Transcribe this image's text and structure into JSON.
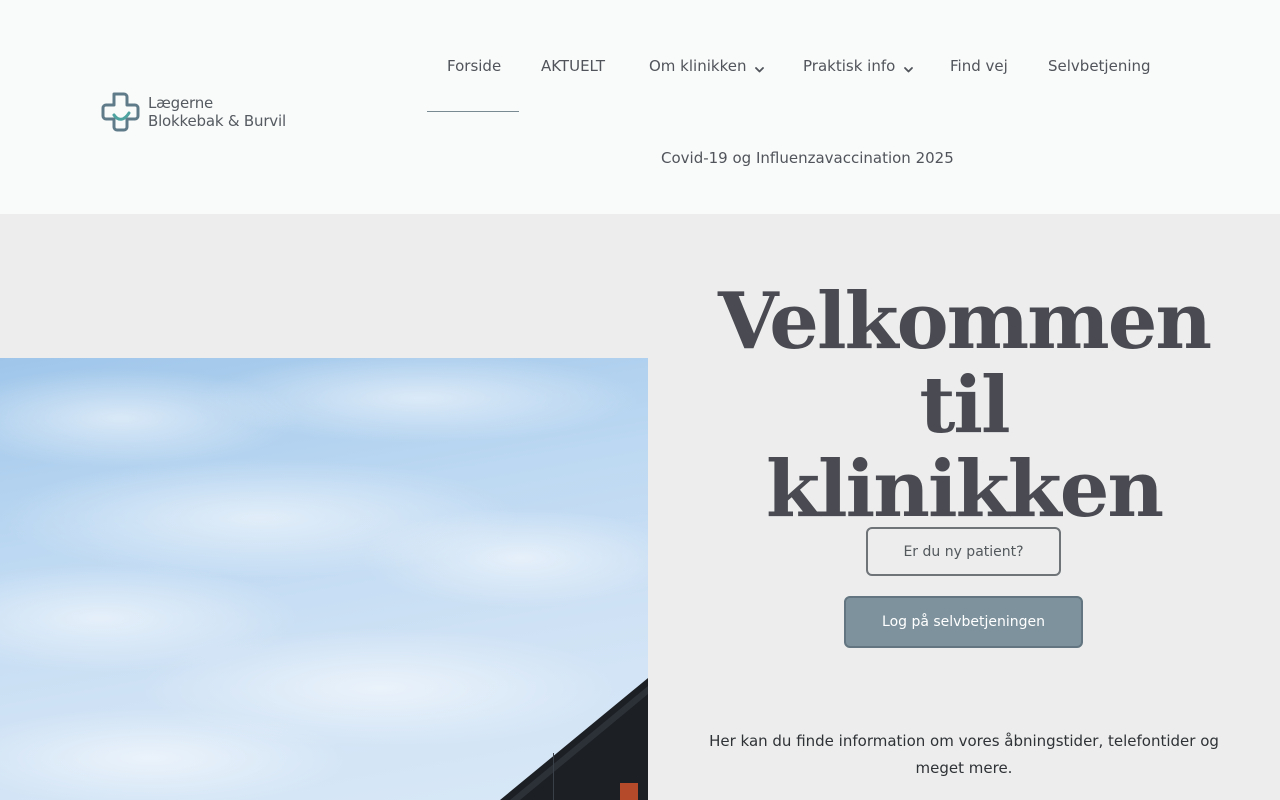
{
  "brand": {
    "logo_line1": "Lægerne",
    "logo_line2": "Blokkebak & Burvil",
    "logo_icon": "medical-cross-icon",
    "accent_color": "#5f9ea0"
  },
  "nav": {
    "forside": "Forside",
    "aktuelt": "AKTUELT",
    "om_klinikken": "Om klinikken",
    "praktisk_info": "Praktisk info",
    "find_vej": "Find vej",
    "selvbetjening": "Selvbetjening",
    "covid": "Covid-19 og Influenzavaccination 2025",
    "active": "Forside",
    "dropdown_icon": "chevron-down-icon"
  },
  "hero": {
    "title_line1": "Velkommen til",
    "title_line2": "klinikken",
    "new_patient_button": "Er du ny patient?",
    "login_button": "Log på selvbetjeningen",
    "info_text": "Her kan du finde information om vores åbningstider, telefontider og meget mere."
  },
  "colors": {
    "header_bg": "#f9fafa",
    "page_bg": "#ecedec",
    "button_primary": "#7d929c",
    "text_dark": "#4a4b52"
  }
}
